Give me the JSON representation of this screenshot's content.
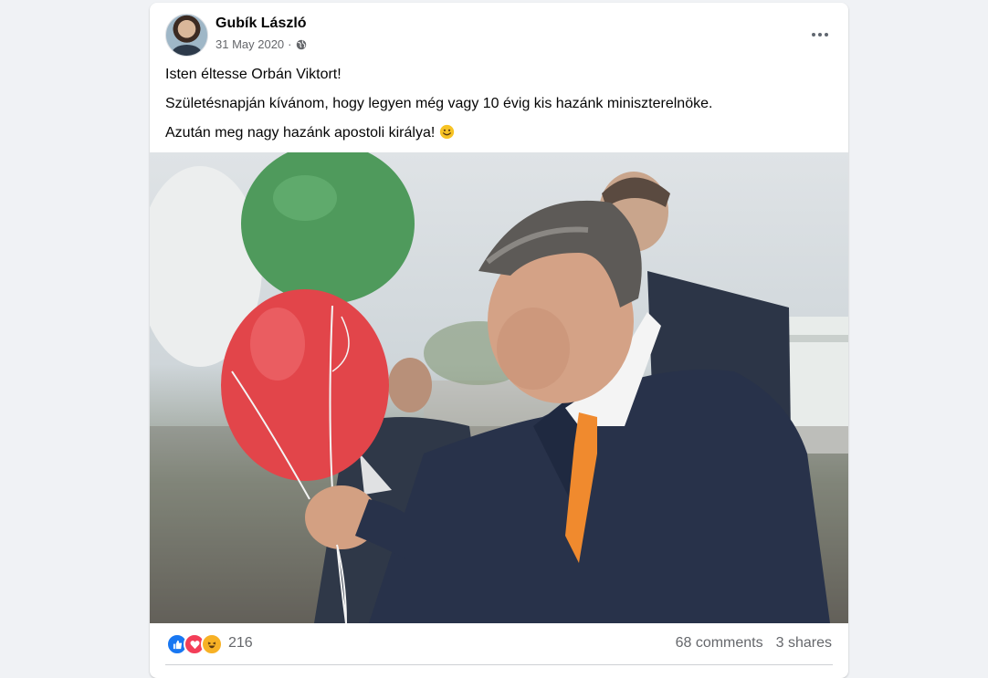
{
  "post": {
    "author": "Gubík László",
    "date": "31 May 2020",
    "separator": "·",
    "text_lines": [
      "Isten éltesse Orbán Viktort!",
      "Születésnapján kívánom, hogy legyen még vagy 10 évig kis hazánk miniszterelnöke.",
      "Azután meg nagy hazánk apostoli királya!"
    ],
    "reaction_count": "216",
    "comments": "68 comments",
    "shares": "3 shares"
  },
  "icons": {
    "audience": "globe-icon",
    "more": "more-options-icon",
    "emoji": "slightly-smiling-face",
    "reactions": [
      "like",
      "love",
      "haha"
    ]
  },
  "colors": {
    "like": "#1877f2",
    "love": "#f33e58",
    "haha": "#f7b125",
    "secondary_text": "#65676b"
  }
}
